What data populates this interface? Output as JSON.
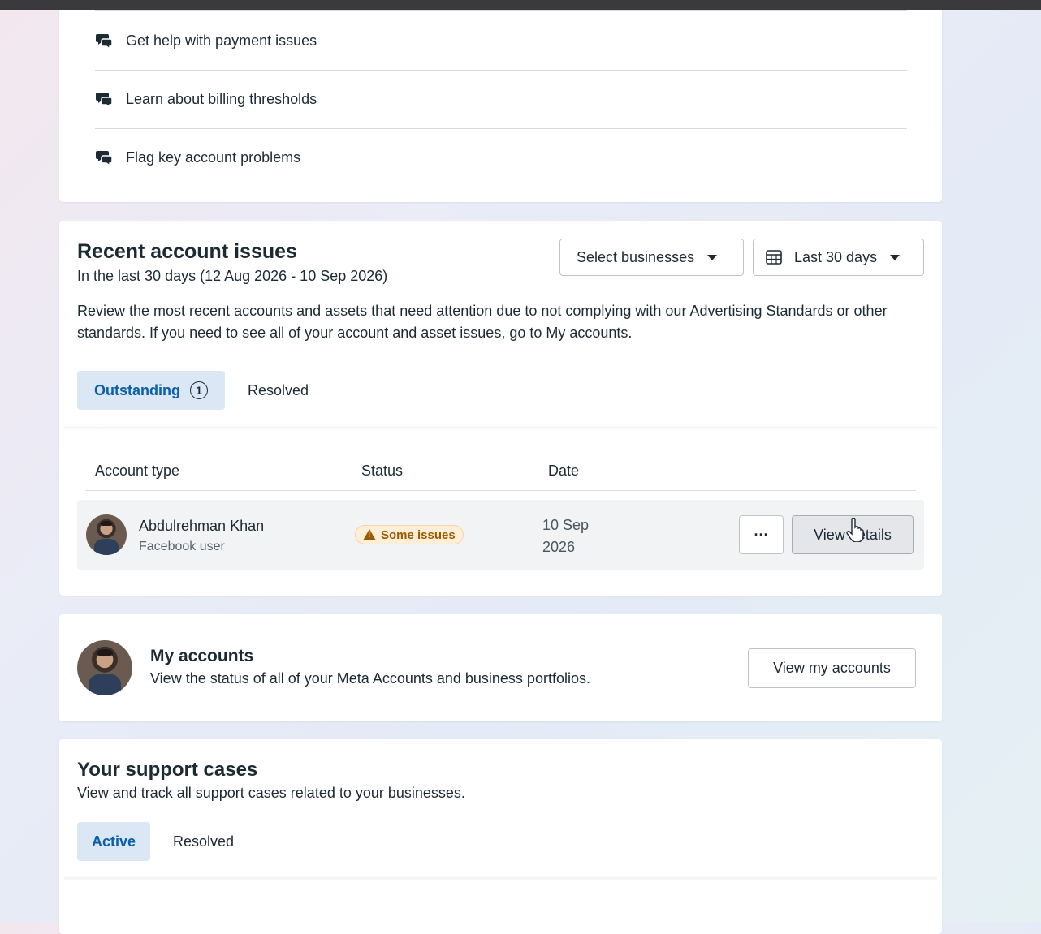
{
  "help_links": [
    {
      "label": "Get help with payment issues",
      "icon": "chat-bubbles-icon"
    },
    {
      "label": "Learn about billing thresholds",
      "icon": "chat-bubbles-icon"
    },
    {
      "label": "Flag key account problems",
      "icon": "chat-bubbles-icon"
    }
  ],
  "issues": {
    "title": "Recent account issues",
    "subtitle": "In the last 30 days (12 Aug 2026 - 10 Sep 2026)",
    "select_businesses": "Select businesses",
    "date_range": "Last 30 days",
    "description": "Review the most recent accounts and assets that need attention due to not complying with our Advertising Standards or other standards. If you need to see all of your account and asset issues, go to My accounts.",
    "tabs": {
      "outstanding": "Outstanding",
      "outstanding_count": "1",
      "resolved": "Resolved"
    },
    "columns": {
      "account_type": "Account type",
      "status": "Status",
      "date": "Date"
    },
    "row": {
      "name": "Abdulrehman Khan",
      "type": "Facebook user",
      "status": "Some issues",
      "date_line1": "10 Sep",
      "date_line2": "2026",
      "more": "···",
      "view_details": "View details"
    }
  },
  "my_accounts": {
    "title": "My accounts",
    "description": "View the status of all of your Meta Accounts and business portfolios.",
    "button": "View my accounts"
  },
  "support": {
    "title": "Your support cases",
    "description": "View and track all support cases related to your businesses.",
    "tabs": {
      "active": "Active",
      "resolved": "Resolved"
    }
  },
  "colors": {
    "accent": "#0b5ea8",
    "tab_bg": "#dbe7f5",
    "warning": "#9a5a00"
  }
}
